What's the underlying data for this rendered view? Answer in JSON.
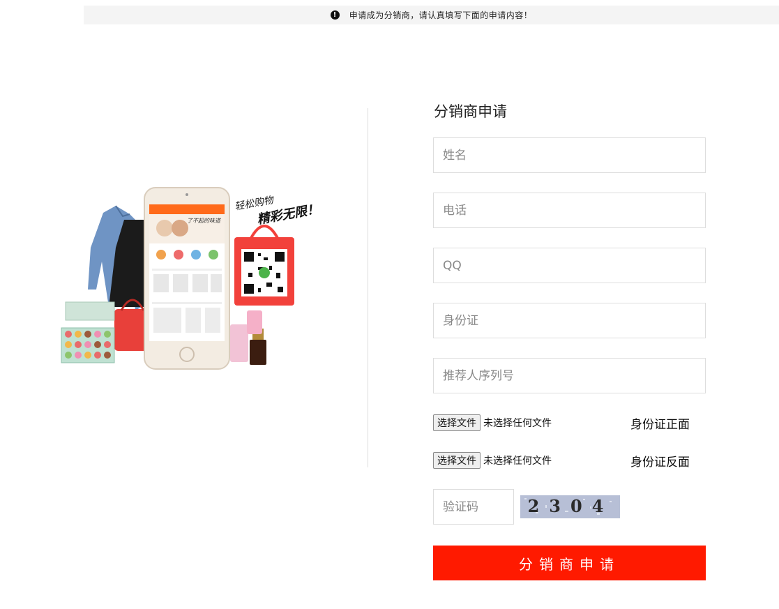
{
  "notice": {
    "icon": "exclamation-circle-icon",
    "text": "申请成为分销商，请认真填写下面的申请内容！"
  },
  "promo": {
    "slogan_line1": "轻松购物",
    "slogan_line2": "精彩无限！",
    "phone_banner": "了不起的味道"
  },
  "form": {
    "title": "分销商申请",
    "name_placeholder": "姓名",
    "phone_placeholder": "电话",
    "qq_placeholder": "QQ",
    "id_placeholder": "身份证",
    "referrer_placeholder": "推荐人序列号",
    "file_button": "选择文件",
    "file_status": "未选择任何文件",
    "id_front_label": "身份证正面",
    "id_back_label": "身份证反面",
    "captcha_placeholder": "验证码",
    "captcha_text": "2304",
    "submit_label": "分销商申请"
  },
  "colors": {
    "accent": "#ff1a00",
    "notice_bg": "#f4f4f4",
    "border": "#dddddd"
  }
}
